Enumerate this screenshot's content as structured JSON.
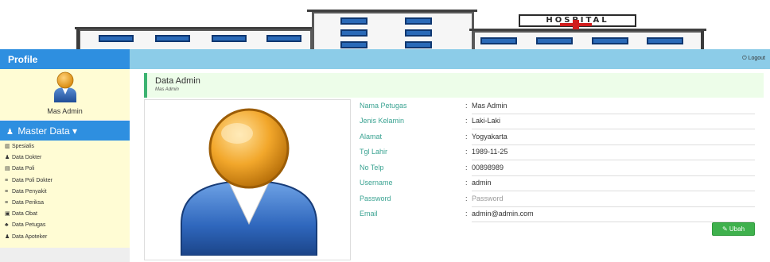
{
  "banner": {
    "sign_text": "HOSPITAL"
  },
  "sidebar": {
    "profile_label": "Profile",
    "user_name": "Mas Admin",
    "master_data_label": "Master Data",
    "master_data_caret": "▾",
    "menu": [
      {
        "label": "Spesialis",
        "icon": "hospital-icon",
        "glyph": "▥"
      },
      {
        "label": "Data Dokter",
        "icon": "user-md-icon",
        "glyph": "♟"
      },
      {
        "label": "Data Poli",
        "icon": "list-alt-icon",
        "glyph": "▤"
      },
      {
        "label": "Data Poli Dokter",
        "icon": "th-list-icon",
        "glyph": "≡"
      },
      {
        "label": "Data Penyakit",
        "icon": "th-list-icon",
        "glyph": "≡"
      },
      {
        "label": "Data Periksa",
        "icon": "th-list-icon",
        "glyph": "≡"
      },
      {
        "label": "Data Obat",
        "icon": "medkit-icon",
        "glyph": "▣"
      },
      {
        "label": "Data Petugas",
        "icon": "users-icon",
        "glyph": "♣"
      },
      {
        "label": "Data Apoteker",
        "icon": "user-icon",
        "glyph": "♟"
      }
    ]
  },
  "topbar": {
    "logout_icon": "⏻",
    "logout_label": "Logout"
  },
  "page": {
    "title": "Data Admin",
    "subtitle": "Mas Admin"
  },
  "form": {
    "fields": [
      {
        "label": "Nama Petugas",
        "value": "Mas Admin"
      },
      {
        "label": "Jenis Kelamin",
        "value": "Laki-Laki"
      },
      {
        "label": "Alamat",
        "value": "Yogyakarta"
      },
      {
        "label": "Tgl Lahir",
        "value": "1989-11-25"
      },
      {
        "label": "No Telp",
        "value": "00898989"
      },
      {
        "label": "Username",
        "value": "admin"
      },
      {
        "label": "Password",
        "placeholder": "Password"
      },
      {
        "label": "Email",
        "value": "admin@admin.com"
      }
    ],
    "colon": ":",
    "submit_label": "Ubah",
    "submit_icon": "✎"
  },
  "colors": {
    "sidebar_blue": "#2e8fe0",
    "topbar_blue": "#8ccce8",
    "panel_yellow": "#fffcd4",
    "heading_green": "#edfde9",
    "label_teal": "#3ba392",
    "button_green": "#3fb14d"
  }
}
